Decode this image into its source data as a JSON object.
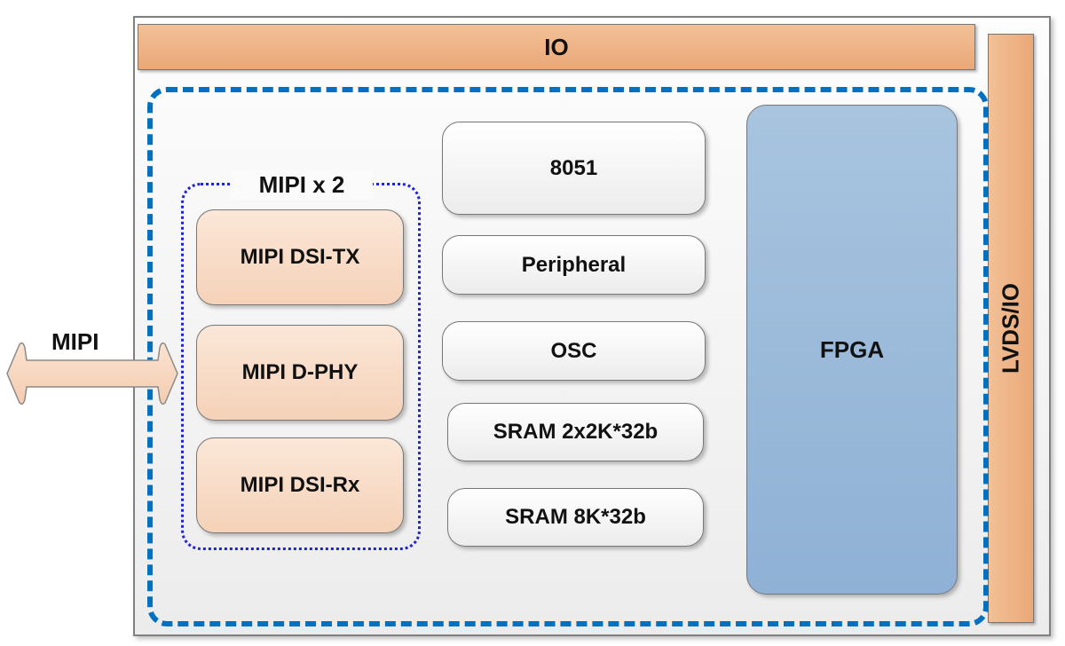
{
  "diagram": {
    "io_top": {
      "label": "IO"
    },
    "io_right": {
      "label": "LVDS/IO"
    },
    "external_interface": {
      "label": "MIPI",
      "direction": "bidirectional"
    },
    "mipi_group": {
      "label": "MIPI x 2",
      "blocks": [
        {
          "label": "MIPI DSI-TX"
        },
        {
          "label": "MIPI D-PHY"
        },
        {
          "label": "MIPI DSI-Rx"
        }
      ]
    },
    "middle_blocks": [
      {
        "label": "8051"
      },
      {
        "label": "Peripheral"
      },
      {
        "label": "OSC"
      },
      {
        "label": "SRAM 2x2K*32b"
      },
      {
        "label": "SRAM 8K*32b"
      }
    ],
    "fpga": {
      "label": "FPGA"
    },
    "colors": {
      "io": "#eeb083",
      "mipi_block": "#f8dcc6",
      "fpga": "#9bbad9",
      "core_border": "#0070c0",
      "mipi_group_border": "#2020e0"
    }
  }
}
